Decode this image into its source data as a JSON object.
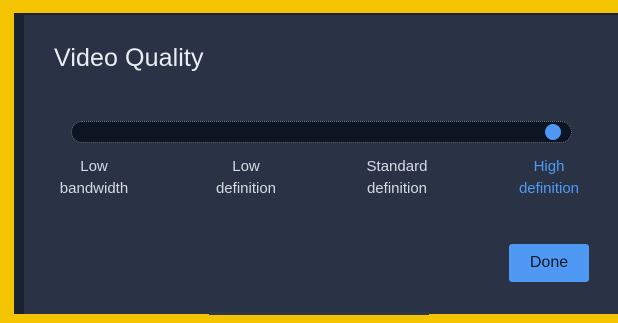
{
  "dialog": {
    "title": "Video Quality",
    "slider": {
      "selected_index": 3,
      "options": [
        {
          "line1": "Low",
          "line2": "bandwidth"
        },
        {
          "line1": "Low",
          "line2": "definition"
        },
        {
          "line1": "Standard",
          "line2": "definition"
        },
        {
          "line1": "High",
          "line2": "definition"
        }
      ]
    },
    "done_label": "Done"
  },
  "colors": {
    "accent": "#4f99f5",
    "frame_border": "#f5c400",
    "dialog_bg": "#2a3346"
  }
}
